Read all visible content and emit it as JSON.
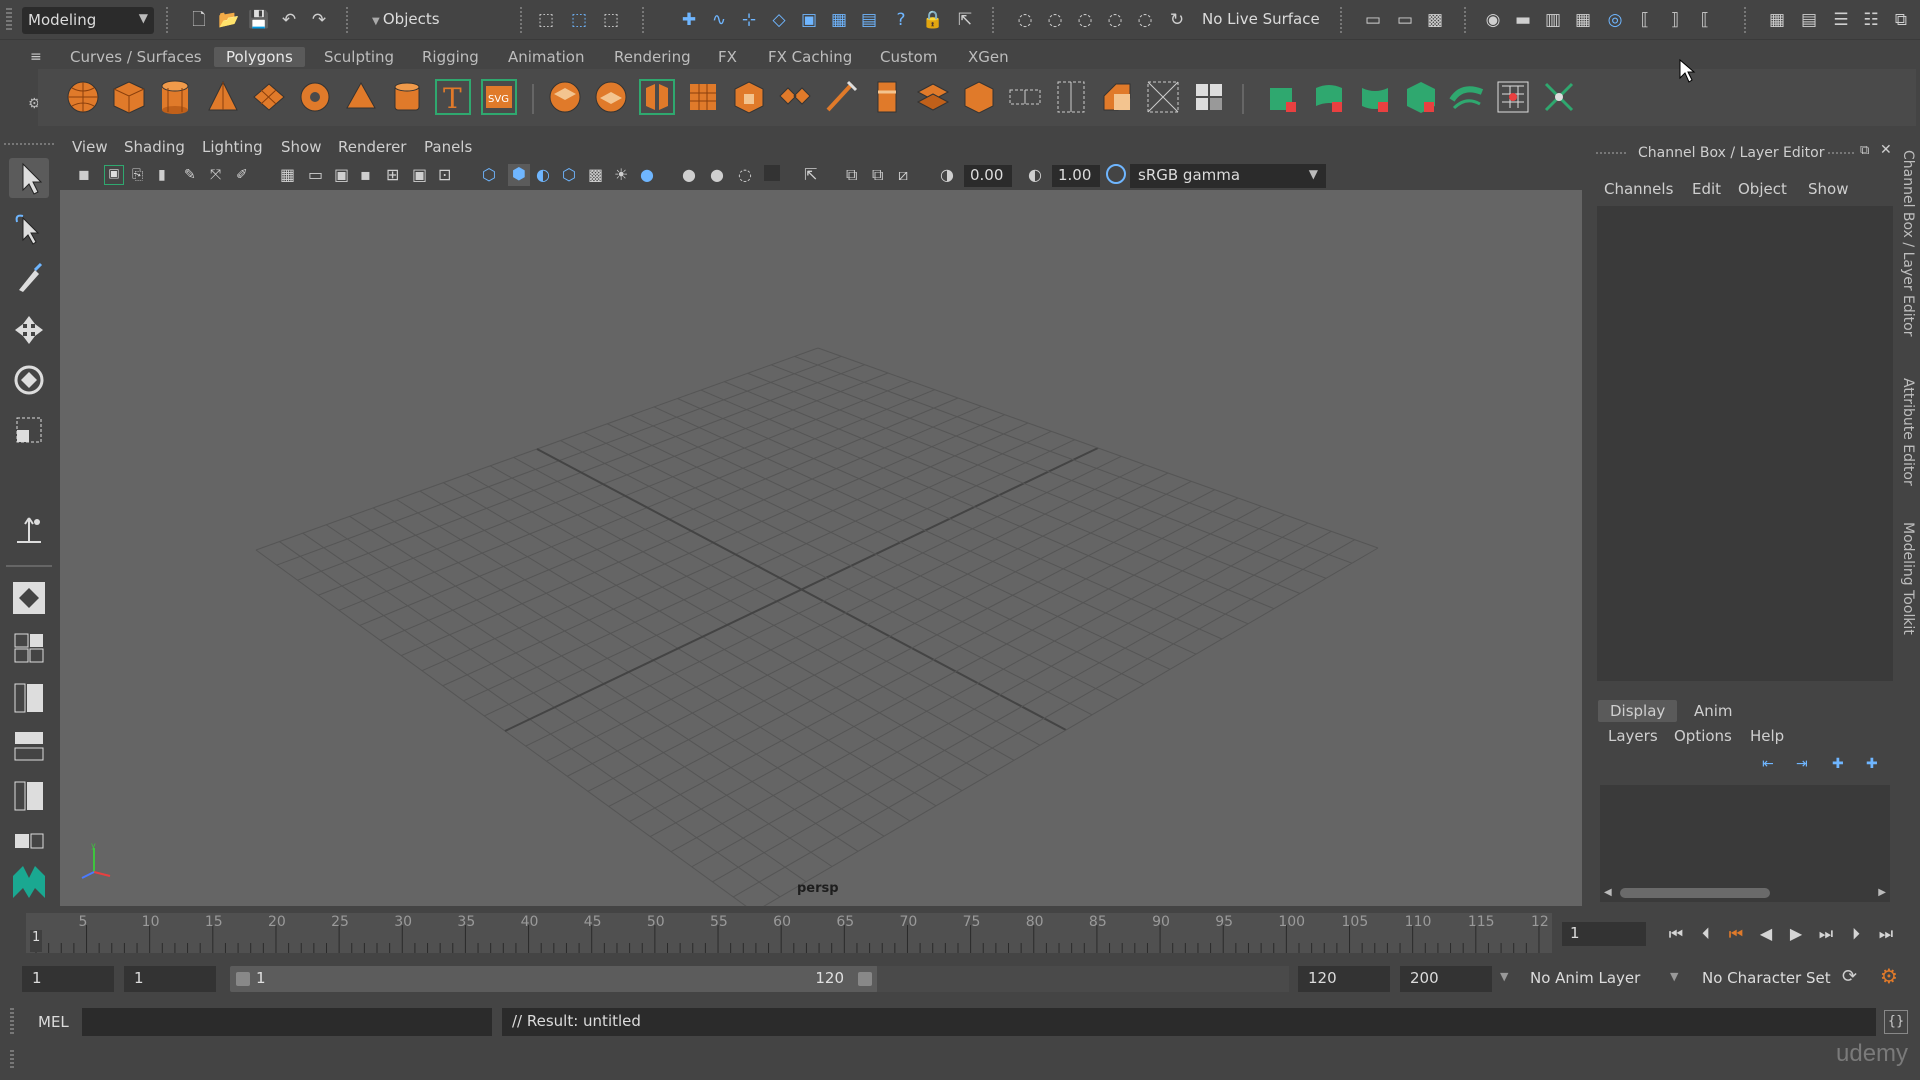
{
  "status_line": {
    "mode": "Modeling",
    "selection_mask": "Objects",
    "live_surface": "No Live Surface"
  },
  "shelf": {
    "tabs": [
      "Curves / Surfaces",
      "Polygons",
      "Sculpting",
      "Rigging",
      "Animation",
      "Rendering",
      "FX",
      "FX Caching",
      "Custom",
      "XGen"
    ],
    "active_tab": "Polygons"
  },
  "viewport": {
    "menu": [
      "View",
      "Shading",
      "Lighting",
      "Show",
      "Renderer",
      "Panels"
    ],
    "exposure": "0.00",
    "gamma": "1.00",
    "color_space": "sRGB gamma",
    "camera_label": "persp"
  },
  "channel_box": {
    "title": "Channel Box / Layer Editor",
    "menu": [
      "Channels",
      "Edit",
      "Object",
      "Show"
    ],
    "layer_tabs": [
      "Display",
      "Anim"
    ],
    "active_layer_tab": "Display",
    "layer_menu": [
      "Layers",
      "Options",
      "Help"
    ],
    "side_tabs": [
      "Channel Box / Layer Editor",
      "Attribute Editor",
      "Modeling Toolkit"
    ]
  },
  "time_slider": {
    "ticks": [
      "5",
      "10",
      "15",
      "20",
      "25",
      "30",
      "35",
      "40",
      "45",
      "50",
      "55",
      "60",
      "65",
      "70",
      "75",
      "80",
      "85",
      "90",
      "95",
      "100",
      "105",
      "110",
      "115",
      "12"
    ],
    "current_marker": "1",
    "current_frame": "1"
  },
  "range_slider": {
    "anim_start": "1",
    "playback_start": "1",
    "range_start_label": "1",
    "range_end_label": "120",
    "playback_end": "120",
    "anim_end": "200",
    "anim_layer": "No Anim Layer",
    "character_set": "No Character Set"
  },
  "command_line": {
    "language": "MEL",
    "result": "// Result: untitled"
  },
  "watermark": "udemy",
  "colors": {
    "background": "#444444",
    "viewport": "#656565",
    "grid": "#555555",
    "accent_blue": "#6fb6ff",
    "shelf_orange": "#e07a2a",
    "shelf_teal": "#2fa86f"
  }
}
